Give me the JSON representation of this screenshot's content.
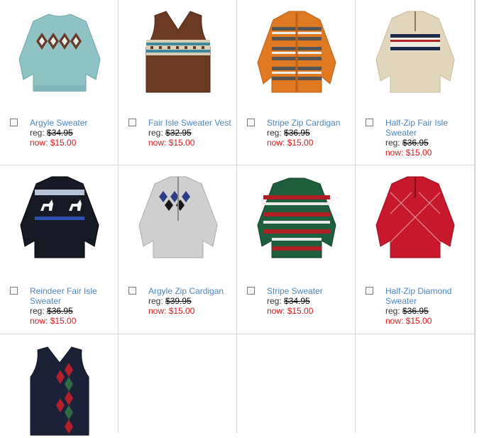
{
  "products": [
    {
      "name": "Argyle Sweater",
      "reg_label": "reg:",
      "reg_price": "$34.95",
      "now_label": "now:",
      "now_price": "$15.00",
      "icon": "argyle-sweater-image"
    },
    {
      "name": "Fair Isle Sweater Vest",
      "reg_label": "reg:",
      "reg_price": "$32.95",
      "now_label": "now:",
      "now_price": "$15.00",
      "icon": "fair-isle-vest-image"
    },
    {
      "name": "Stripe Zip Cardigan",
      "reg_label": "reg:",
      "reg_price": "$36.95",
      "now_label": "now:",
      "now_price": "$15.00",
      "icon": "stripe-zip-cardigan-image"
    },
    {
      "name": "Half-Zip Fair Isle Sweater",
      "reg_label": "reg:",
      "reg_price": "$36.95",
      "now_label": "now:",
      "now_price": "$15.00",
      "icon": "half-zip-fair-isle-image"
    },
    {
      "name": "Reindeer Fair Isle Sweater",
      "reg_label": "reg:",
      "reg_price": "$36.95",
      "now_label": "now:",
      "now_price": "$15.00",
      "icon": "reindeer-sweater-image"
    },
    {
      "name": "Argyle Zip Cardigan",
      "reg_label": "reg:",
      "reg_price": "$39.95",
      "now_label": "now:",
      "now_price": "$15.00",
      "icon": "argyle-zip-cardigan-image"
    },
    {
      "name": "Stripe Sweater",
      "reg_label": "reg:",
      "reg_price": "$34.95",
      "now_label": "now:",
      "now_price": "$15.00",
      "icon": "stripe-sweater-image"
    },
    {
      "name": "Half-Zip Diamond Sweater",
      "reg_label": "reg:",
      "reg_price": "$36.95",
      "now_label": "now:",
      "now_price": "$15.00",
      "icon": "half-zip-diamond-image"
    },
    {
      "icon": "argyle-vest-image"
    }
  ],
  "colors": {
    "link": "#4a86bd",
    "sale": "#d21a1a",
    "border": "#d8d8d8"
  }
}
